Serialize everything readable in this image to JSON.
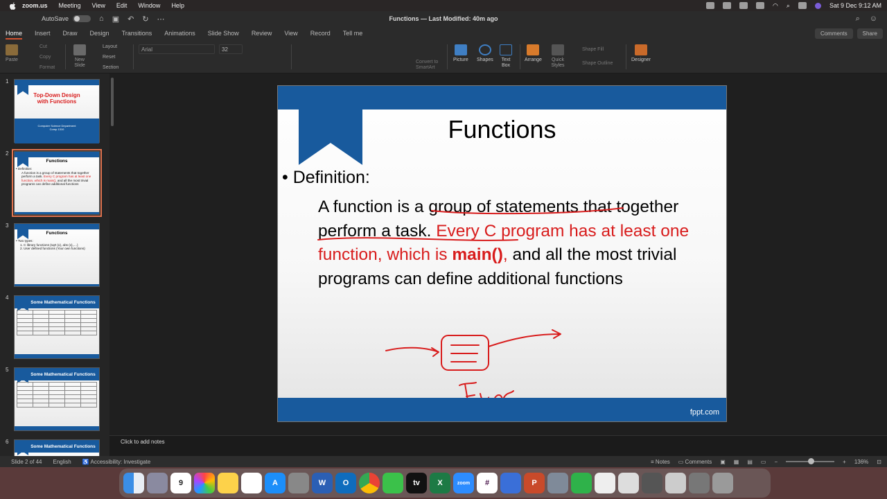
{
  "menubar": {
    "app": "zoom.us",
    "items": [
      "Meeting",
      "View",
      "Edit",
      "Window",
      "Help"
    ],
    "clock": "Sat 9 Dec  9:12 AM"
  },
  "titlebar": {
    "autosave": "AutoSave",
    "autosave_state": "OFF",
    "title": "Functions — Last Modified: 40m ago"
  },
  "tabs": [
    "Home",
    "Insert",
    "Draw",
    "Design",
    "Transitions",
    "Animations",
    "Slide Show",
    "Review",
    "View",
    "Record",
    "Tell me"
  ],
  "tab_buttons": {
    "comments": "Comments",
    "share": "Share"
  },
  "ribbon": {
    "paste": "Paste",
    "cut": "Cut",
    "copy": "Copy",
    "format": "Format",
    "new_slide": "New Slide",
    "layout": "Layout",
    "reset": "Reset",
    "section": "Section",
    "font": "Arial",
    "size": "32",
    "convert": "Convert to SmartArt",
    "picture": "Picture",
    "shapes": "Shapes",
    "textbox": "Text Box",
    "arrange": "Arrange",
    "quick_styles": "Quick Styles",
    "shape_fill": "Shape Fill",
    "shape_outline": "Shape Outline",
    "designer": "Designer"
  },
  "thumbs": [
    {
      "num": "1",
      "title": "Top-Down Design with Functions",
      "sub1": "Computer Science Department",
      "sub2": "Comp 1310"
    },
    {
      "num": "2",
      "title": "Functions",
      "body_a": "• Definition:",
      "body_b": "A function is a group of statements that together perform a task. ",
      "body_red": "Every C program has at least one function, which is main(),",
      "body_c": " and all the most trivial programs can define additional functions"
    },
    {
      "num": "3",
      "title": "Functions",
      "body_a": "• Two types:",
      "body_b": "1. C library functions (sqrt (x), abs (x),....)",
      "body_c": "2. User defined functions (Your own functions)"
    },
    {
      "num": "4",
      "title": "Some Mathematical Functions"
    },
    {
      "num": "5",
      "title": "Some Mathematical Functions"
    },
    {
      "num": "6",
      "title": "Some Mathematical Functions"
    }
  ],
  "slide": {
    "title": "Functions",
    "bullet": "Definition:",
    "text_a": "A function is a group of statements that together perform a task. ",
    "text_red": "Every C program has at least one function, which is ",
    "text_main": "main()",
    "text_comma": ",",
    "text_b": " and all the most trivial programs can define additional functions",
    "footer": "fppt.com",
    "accent": "#185a9d",
    "red": "#d81c1c"
  },
  "notes": {
    "placeholder": "Click to add notes"
  },
  "status": {
    "slide": "Slide 2 of 44",
    "lang": "English",
    "accessibility": "Accessibility: Investigate",
    "notes": "Notes",
    "comments": "Comments",
    "zoom": "136%"
  }
}
